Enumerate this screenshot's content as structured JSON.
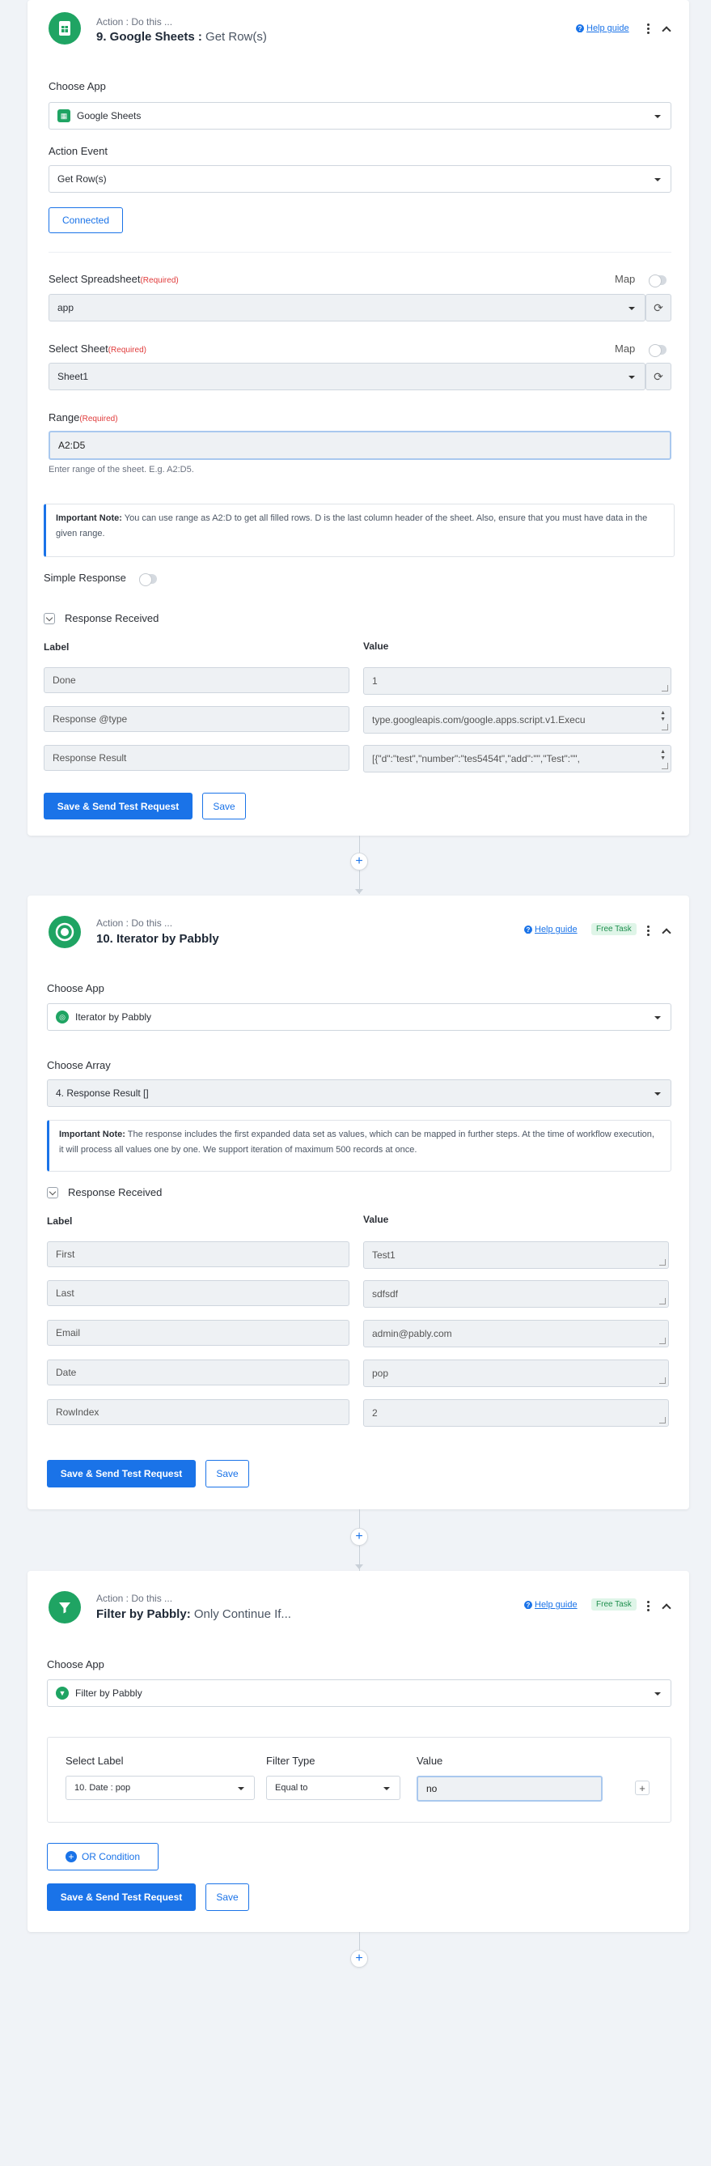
{
  "step9": {
    "subtitle": "Action : Do this ...",
    "title": "9. Google Sheets : ",
    "title_light": "Get Row(s)",
    "help": "Help guide",
    "choose_app_label": "Choose App",
    "app": "Google Sheets",
    "action_event_label": "Action Event",
    "action_event": "Get Row(s)",
    "connected": "Connected",
    "spreadsheet_label": "Select Spreadsheet",
    "required": "(Required)",
    "map": "Map",
    "spreadsheet": "app",
    "sheet_label": "Select Sheet",
    "sheet": "Sheet1",
    "range_label": "Range",
    "range": "A2:D5",
    "range_hint": "Enter range of the sheet. E.g. A2:D5.",
    "note_bold": "Important Note:",
    "note_text": " You can use range as A2:D to get all filled rows. D is the last column header of the sheet. Also, ensure that you must have data in the given range.",
    "simple_response": "Simple Response",
    "response_received": "Response Received",
    "col_label": "Label",
    "col_value": "Value",
    "rows": [
      {
        "label": "Done",
        "value": "1"
      },
      {
        "label": "Response @type",
        "value": "type.googleapis.com/google.apps.script.v1.Execu"
      },
      {
        "label": "Response Result",
        "value": "[{\"d\":\"test\",\"number\":\"tes5454t\",\"add\":\"\",\"Test\":\"\","
      }
    ],
    "save_send": "Save & Send Test Request",
    "save": "Save"
  },
  "step10": {
    "subtitle": "Action : Do this ...",
    "title": "10. Iterator by Pabbly",
    "help": "Help guide",
    "badge": "Free Task",
    "choose_app_label": "Choose App",
    "app": "Iterator by Pabbly",
    "array_label": "Choose Array",
    "array": "4. Response Result []",
    "note_bold": "Important Note:",
    "note_text": " The response includes the first expanded data set as values, which can be mapped in further steps. At the time of workflow execution, it will process all values one by one. We support iteration of maximum 500 records at once.",
    "response_received": "Response Received",
    "col_label": "Label",
    "col_value": "Value",
    "rows": [
      {
        "label": "First",
        "value": "Test1"
      },
      {
        "label": "Last",
        "value": "sdfsdf"
      },
      {
        "label": "Email",
        "value": "admin@pably.com"
      },
      {
        "label": "Date",
        "value": "pop"
      },
      {
        "label": "RowIndex",
        "value": "2"
      }
    ],
    "save_send": "Save & Send Test Request",
    "save": "Save"
  },
  "step11": {
    "subtitle": "Action : Do this ...",
    "title": "Filter by Pabbly: ",
    "title_light": "Only Continue If...",
    "help": "Help guide",
    "badge": "Free Task",
    "choose_app_label": "Choose App",
    "app": "Filter by Pabbly",
    "select_label_label": "Select Label",
    "select_label": "10. Date : pop",
    "filter_type_label": "Filter Type",
    "filter_type": "Equal to",
    "value_label": "Value",
    "value": "no",
    "or_condition": "OR Condition",
    "save_send": "Save & Send Test Request",
    "save": "Save"
  },
  "colors": {
    "accent": "#1a73e8",
    "sheets_green": "#1fa463",
    "required": "#e03b3b"
  },
  "icons": [
    "sheets-icon",
    "iterator-icon",
    "filter-icon",
    "help-icon",
    "kebab-icon",
    "chevron-up-icon",
    "refresh-icon",
    "plus-icon"
  ]
}
